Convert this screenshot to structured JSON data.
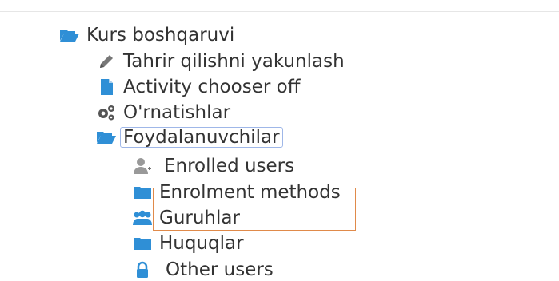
{
  "nav": {
    "kurs": {
      "label": "Kurs boshqaruvi",
      "icon": "folder-open-icon"
    },
    "tahrir": {
      "label": "Tahrir qilishni yakunlash",
      "icon": "pencil-icon"
    },
    "activity": {
      "label": "Activity chooser off",
      "icon": "document-icon"
    },
    "ornat": {
      "label": "O'rnatishlar",
      "icon": "gears-icon"
    },
    "foyd": {
      "label": "Foydalanuvchilar",
      "icon": "folder-open-icon"
    },
    "enrolled": {
      "label": "Enrolled users",
      "icon": "user-add-icon"
    },
    "enrol": {
      "label": "Enrolment methods",
      "icon": "folder-icon"
    },
    "guruh": {
      "label": "Guruhlar",
      "icon": "users-icon"
    },
    "huquq": {
      "label": "Huquqlar",
      "icon": "folder-icon"
    },
    "other": {
      "label": "Other users",
      "icon": "lock-icon"
    }
  },
  "colors": {
    "icon_blue": "#2f8fd6",
    "icon_gray": "#777777",
    "highlight": "#e08a4a",
    "focus_border": "#9fb7e8"
  }
}
